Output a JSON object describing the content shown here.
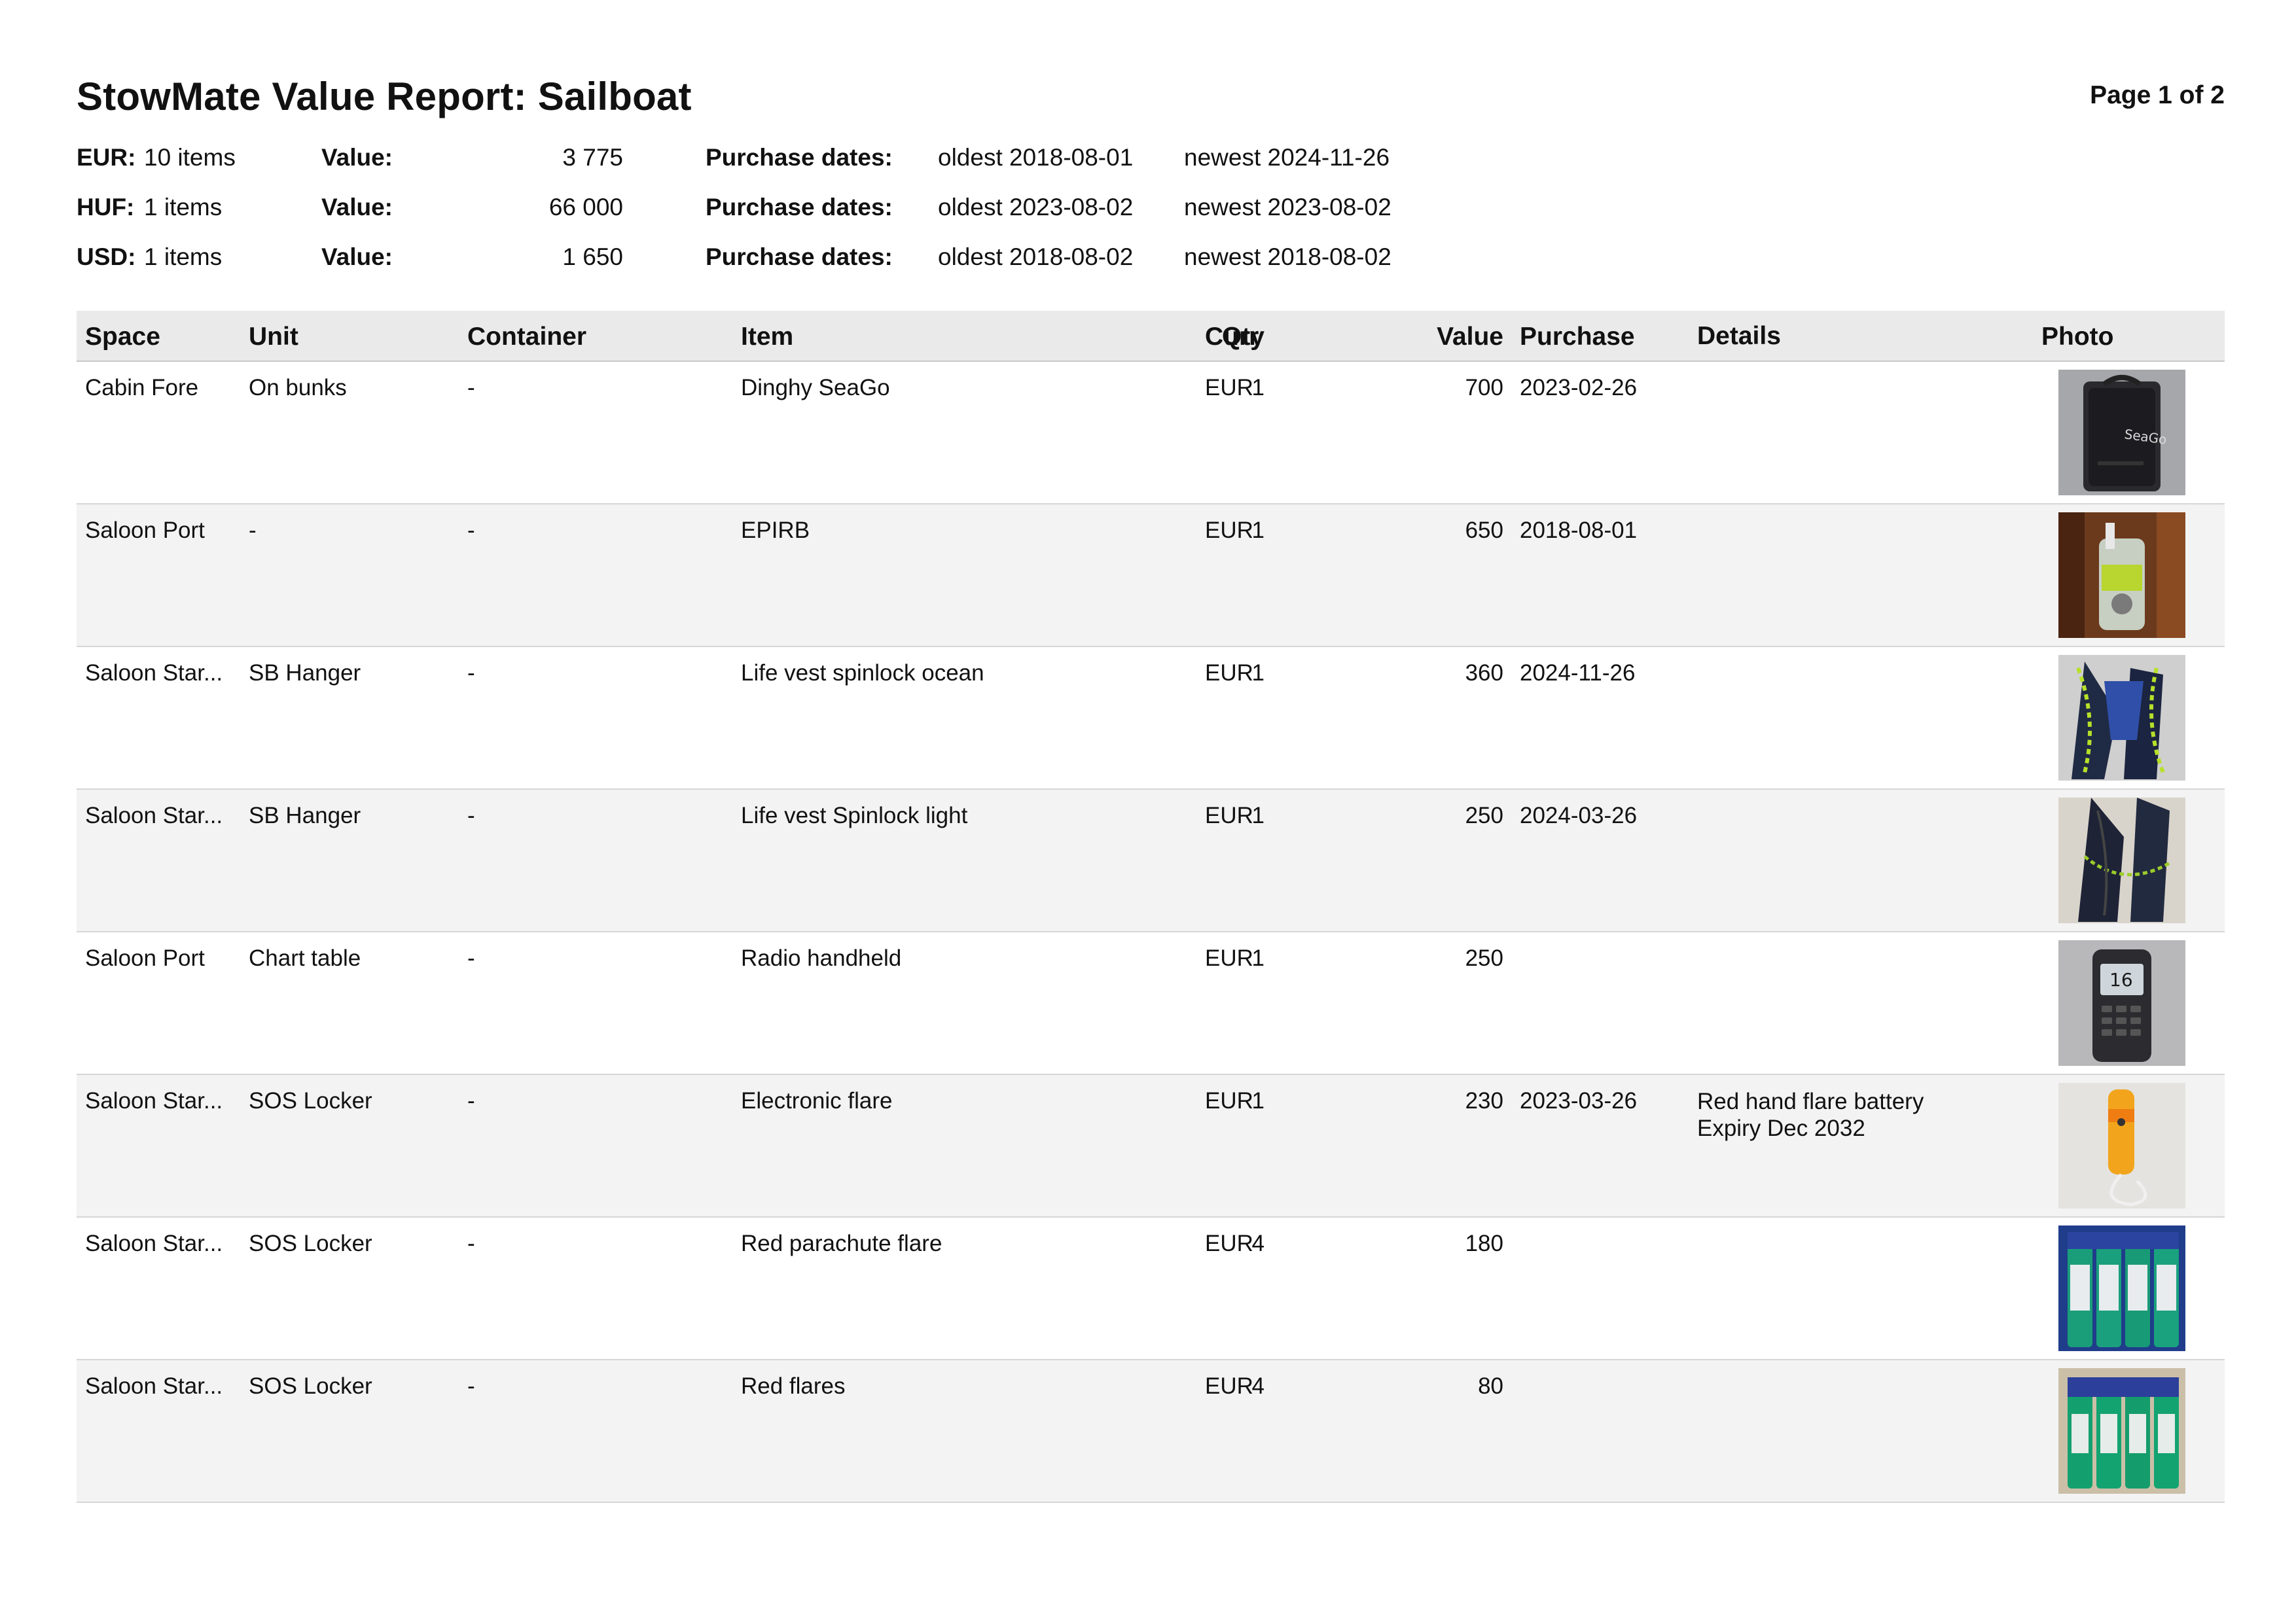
{
  "header": {
    "title": "StowMate Value Report: Sailboat",
    "page_label": "Page 1 of 2"
  },
  "summary": [
    {
      "currency": "EUR:",
      "items": "10 items",
      "value_label": "Value:",
      "value": "3 775",
      "dates_label": "Purchase dates:",
      "oldest": "oldest 2018-08-01",
      "newest": "newest 2024-11-26"
    },
    {
      "currency": "HUF:",
      "items": "1 items",
      "value_label": "Value:",
      "value": "66 000",
      "dates_label": "Purchase dates:",
      "oldest": "oldest 2023-08-02",
      "newest": "newest 2023-08-02"
    },
    {
      "currency": "USD:",
      "items": "1 items",
      "value_label": "Value:",
      "value": "1 650",
      "dates_label": "Purchase dates:",
      "oldest": "oldest 2018-08-02",
      "newest": "newest 2018-08-02"
    }
  ],
  "table": {
    "columns": [
      "Space",
      "Unit",
      "Container",
      "Item",
      "Qty",
      "Curr",
      "Value",
      "Purchase",
      "Details",
      "Photo"
    ],
    "rows": [
      {
        "space": "Cabin Fore",
        "unit": "On bunks",
        "container": "-",
        "item": "Dinghy SeaGo",
        "qty": "1",
        "curr": "EUR",
        "value": "700",
        "purchase": "2023-02-26",
        "details": "",
        "photo_icon": "dinghy-bag-photo"
      },
      {
        "space": "Saloon Port",
        "unit": "-",
        "container": "-",
        "item": "EPIRB",
        "qty": "1",
        "curr": "EUR",
        "value": "650",
        "purchase": "2018-08-01",
        "details": "",
        "photo_icon": "epirb-photo"
      },
      {
        "space": "Saloon Star...",
        "unit": "SB Hanger",
        "container": "-",
        "item": "Life vest spinlock ocean",
        "qty": "1",
        "curr": "EUR",
        "value": "360",
        "purchase": "2024-11-26",
        "details": "",
        "photo_icon": "life-vest-photo"
      },
      {
        "space": "Saloon Star...",
        "unit": "SB Hanger",
        "container": "-",
        "item": "Life vest Spinlock light",
        "qty": "1",
        "curr": "EUR",
        "value": "250",
        "purchase": "2024-03-26",
        "details": "",
        "photo_icon": "life-vest-light-photo"
      },
      {
        "space": "Saloon Port",
        "unit": "Chart table",
        "container": "-",
        "item": "Radio handheld",
        "qty": "1",
        "curr": "EUR",
        "value": "250",
        "purchase": "",
        "details": "",
        "photo_icon": "radio-handheld-photo"
      },
      {
        "space": "Saloon Star...",
        "unit": "SOS Locker",
        "container": "-",
        "item": "Electronic flare",
        "qty": "1",
        "curr": "EUR",
        "value": "230",
        "purchase": "2023-03-26",
        "details": "Red hand flare battery\nExpiry Dec 2032",
        "photo_icon": "electronic-flare-photo"
      },
      {
        "space": "Saloon Star...",
        "unit": "SOS Locker",
        "container": "-",
        "item": "Red parachute flare",
        "qty": "4",
        "curr": "EUR",
        "value": "180",
        "purchase": "",
        "details": "",
        "photo_icon": "parachute-flares-photo"
      },
      {
        "space": "Saloon Star...",
        "unit": "SOS Locker",
        "container": "-",
        "item": "Red flares",
        "qty": "4",
        "curr": "EUR",
        "value": "80",
        "purchase": "",
        "details": "",
        "photo_icon": "red-flares-photo"
      }
    ]
  }
}
